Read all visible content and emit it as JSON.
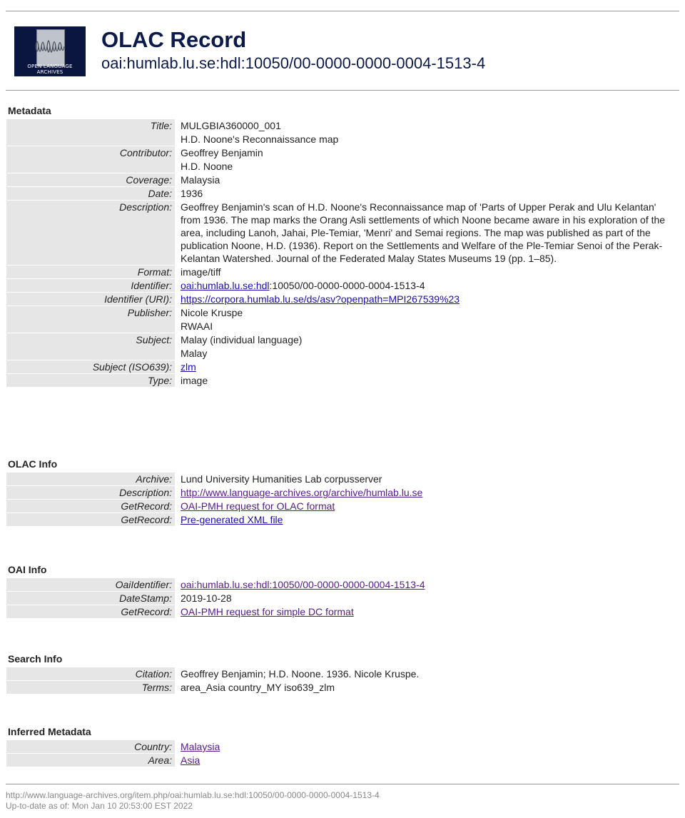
{
  "header": {
    "title": "OLAC Record",
    "identifier": "oai:humlab.lu.se:hdl:10050/00-0000-0000-0004-1513-4",
    "logo_caption": "OPEN LANGUAGE ARCHIVES"
  },
  "metadata": {
    "heading": "Metadata",
    "title_label": "Title:",
    "title_1": "MULGBIA360000_001",
    "title_2": "H.D. Noone's Reconnaissance map",
    "contributor_label": "Contributor:",
    "contributor_1": "Geoffrey Benjamin",
    "contributor_2": "H.D. Noone",
    "coverage_label": "Coverage:",
    "coverage": "Malaysia",
    "date_label": "Date:",
    "date": "1936",
    "description_label": "Description:",
    "description": "Geoffrey Benjamin's scan of H.D. Noone's Reconnaissance map of 'Parts of Upper Perak and Ulu Kelantan' from 1936. The map marks the Orang Asli settlements of which Noone became aware in his exploration of the area, including Lanoh, Jahai, Ple-Temiar, 'Menri' and Semai regions. The map was published as part of the publication Noone, H.D. (1936). Report on the Settlements and Welfare of the Ple-Temiar Senoi of the Perak-Kelantan Watershed. Journal of the Federated Malay States Museums 19 (pp. 1–85).",
    "format_label": "Format:",
    "format": "image/tiff",
    "identifier_label": "Identifier:",
    "identifier_link": "oai:humlab.lu.se:hdl",
    "identifier_rest": ":10050/00-0000-0000-0004-1513-4",
    "identifier_uri_label": "Identifier (URI):",
    "identifier_uri": "https://corpora.humlab.lu.se/ds/asv?openpath=MPI267539%23",
    "publisher_label": "Publisher:",
    "publisher_1": "Nicole Kruspe",
    "publisher_2": "RWAAI",
    "subject_label": "Subject:",
    "subject_1": "Malay (individual language)",
    "subject_2": "Malay",
    "subject_iso_label": "Subject (ISO639):",
    "subject_iso": "zlm",
    "type_label": "Type:",
    "type": "image"
  },
  "olac_info": {
    "heading": "OLAC Info",
    "archive_label": "Archive:",
    "archive": "Lund University Humanities Lab corpusserver",
    "description_label": "Description:",
    "description": "http://www.language-archives.org/archive/humlab.lu.se",
    "getrecord_label": "GetRecord:",
    "getrecord_1": "OAI-PMH request for OLAC format",
    "getrecord_2": "Pre-generated XML file"
  },
  "oai_info": {
    "heading": "OAI Info",
    "oaiidentifier_label": "OaiIdentifier:",
    "oaiidentifier": "oai:humlab.lu.se:hdl:10050/00-0000-0000-0004-1513-4",
    "datestamp_label": "DateStamp:",
    "datestamp": "2019-10-28",
    "getrecord_label": "GetRecord:",
    "getrecord": "OAI-PMH request for simple DC format"
  },
  "search_info": {
    "heading": "Search Info",
    "citation_label": "Citation:",
    "citation": "Geoffrey Benjamin; H.D. Noone. 1936. Nicole Kruspe.",
    "terms_label": "Terms:",
    "terms": "area_Asia country_MY iso639_zlm"
  },
  "inferred": {
    "heading": "Inferred Metadata",
    "country_label": "Country:",
    "country": "Malaysia",
    "area_label": "Area:",
    "area": "Asia"
  },
  "footer": {
    "url": "http://www.language-archives.org/item.php/oai:humlab.lu.se:hdl:10050/00-0000-0000-0004-1513-4",
    "updated": "Up-to-date as of: Mon Jan 10 20:53:00 EST 2022"
  },
  "colors": {
    "header_text": "#0c1a4a",
    "label_bg": "#e6e6e6",
    "link": "#1a0dab",
    "visited_link": "#551a8b"
  }
}
